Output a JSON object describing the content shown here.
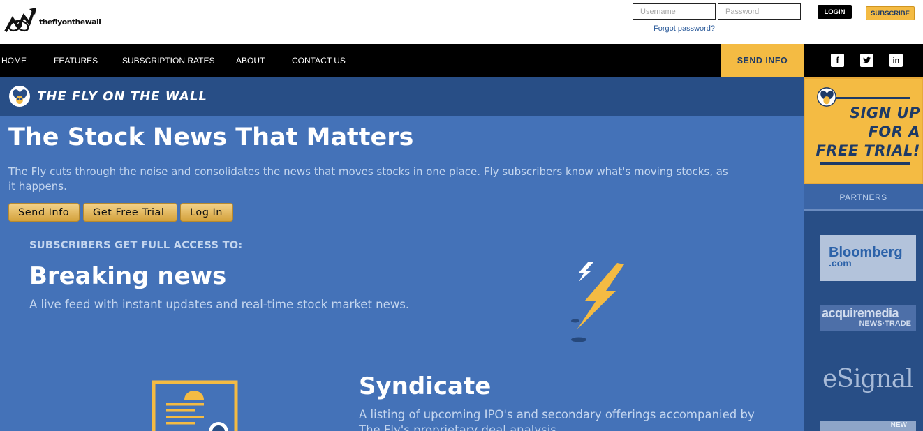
{
  "brand": {
    "name": "theflyonthewall"
  },
  "login": {
    "username_placeholder": "Username",
    "password_placeholder": "Password",
    "forgot_label": "Forgot password?",
    "login_label": "LOGIN",
    "subscribe_label": "SUBSCRIBE"
  },
  "nav": {
    "items": [
      {
        "label": "HOME"
      },
      {
        "label": "FEATURES"
      },
      {
        "label": "SUBSCRIPTION RATES"
      },
      {
        "label": "ABOUT"
      },
      {
        "label": "CONTACT US"
      }
    ],
    "send_info_label": "SEND INFO",
    "social": {
      "facebook": "f",
      "twitter": "t",
      "linkedin": "in"
    }
  },
  "main": {
    "section_title": "THE FLY ON THE WALL",
    "headline": "The Stock News That Matters",
    "intro": "The Fly cuts through the noise and consolidates the news that moves stocks in one place. Fly subscribers know what's moving stocks, as it happens.",
    "cta": {
      "send_info": "Send Info",
      "free_trial": "Get Free Trial",
      "log_in": "Log In"
    },
    "access_heading": "SUBSCRIBERS GET FULL ACCESS TO:",
    "features": [
      {
        "title": "Breaking news",
        "description": "A live feed with instant updates and real-time stock market news.",
        "icon": "lightning-bolt-icon"
      },
      {
        "title": "Syndicate",
        "description": "A listing of upcoming IPO's and secondary offerings accompanied by The Fly's proprietary deal analysis.",
        "icon": "document-icon"
      }
    ]
  },
  "sidebar": {
    "signup_lines": [
      "SIGN UP",
      "FOR A",
      "FREE TRIAL!"
    ],
    "partners_label": "PARTNERS",
    "partners": [
      {
        "line1": "Bloomberg",
        "line2": ".com"
      },
      {
        "line1": "acquiremedia",
        "line2": "NEWS·TRADE"
      },
      {
        "line1": "eSignal"
      },
      {
        "line1": "NEW"
      }
    ]
  },
  "colors": {
    "main_blue": "#4472b8",
    "dark_blue": "#284e86",
    "accent_yellow": "#f4bb43",
    "nav_black": "#000000"
  }
}
